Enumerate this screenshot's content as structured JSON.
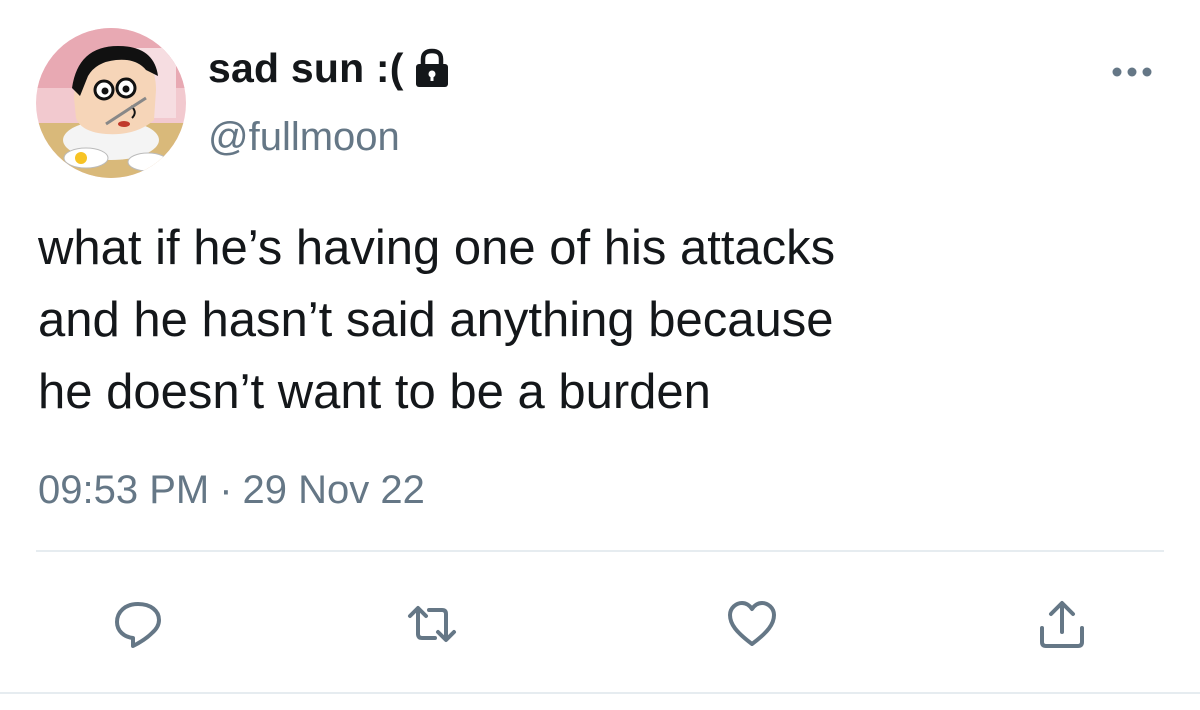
{
  "user": {
    "display_name": "sad sun :(",
    "handle": "@fullmoon",
    "protected": true,
    "avatar_icon": "cartoon-avatar"
  },
  "tweet": {
    "lines": [
      "what if he’s having one of his attacks",
      "and he hasn’t said anything because",
      "he doesn’t want to be a burden"
    ],
    "time": "09:53 PM",
    "separator": "·",
    "date": "29 Nov 22"
  },
  "actions": {
    "reply_icon": "reply-icon",
    "retweet_icon": "retweet-icon",
    "like_icon": "like-icon",
    "share_icon": "share-icon",
    "more_icon": "more-options-icon"
  },
  "colors": {
    "icon": "#657786",
    "text": "#14171a",
    "divider": "#e6ecf0"
  }
}
